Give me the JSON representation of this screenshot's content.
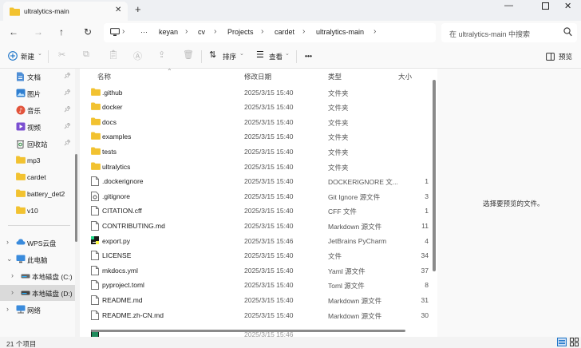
{
  "tab": {
    "title": "ultralytics-main"
  },
  "address": {
    "breadcrumbs": [
      "keyan",
      "cv",
      "Projects",
      "cardet",
      "ultralytics-main"
    ],
    "ellipsis": "···"
  },
  "search": {
    "placeholder": "在 ultralytics-main 中搜索"
  },
  "toolbar": {
    "new_label": "新建",
    "sort_label": "排序",
    "view_label": "查看",
    "more_label": "•••",
    "preview_label": "预览"
  },
  "sidebar": {
    "pinned": [
      {
        "label": "文档",
        "icon": "documents-icon"
      },
      {
        "label": "图片",
        "icon": "pictures-icon"
      },
      {
        "label": "音乐",
        "icon": "music-icon"
      },
      {
        "label": "视频",
        "icon": "videos-icon"
      },
      {
        "label": "回收站",
        "icon": "recycle-bin-icon"
      }
    ],
    "folders": [
      "mp3",
      "cardet",
      "battery_det2",
      "v10"
    ],
    "tree": [
      {
        "label": "WPS云盘"
      },
      {
        "label": "此电脑"
      },
      {
        "label": "本地磁盘 (C:)"
      },
      {
        "label": "本地磁盘 (D:)"
      },
      {
        "label": "网络"
      }
    ]
  },
  "columns": {
    "name": "名称",
    "date": "修改日期",
    "type": "类型",
    "size": "大小"
  },
  "files": [
    {
      "name": ".github",
      "date": "2025/3/15 15:40",
      "type": "文件夹",
      "size": "",
      "icon": "folder"
    },
    {
      "name": "docker",
      "date": "2025/3/15 15:40",
      "type": "文件夹",
      "size": "",
      "icon": "folder"
    },
    {
      "name": "docs",
      "date": "2025/3/15 15:40",
      "type": "文件夹",
      "size": "",
      "icon": "folder"
    },
    {
      "name": "examples",
      "date": "2025/3/15 15:40",
      "type": "文件夹",
      "size": "",
      "icon": "folder"
    },
    {
      "name": "tests",
      "date": "2025/3/15 15:40",
      "type": "文件夹",
      "size": "",
      "icon": "folder"
    },
    {
      "name": "ultralytics",
      "date": "2025/3/15 15:40",
      "type": "文件夹",
      "size": "",
      "icon": "folder"
    },
    {
      "name": ".dockerignore",
      "date": "2025/3/15 15:40",
      "type": "DOCKERIGNORE 文...",
      "size": "1",
      "icon": "file"
    },
    {
      "name": ".gitignore",
      "date": "2025/3/15 15:40",
      "type": "Git Ignore 源文件",
      "size": "3",
      "icon": "gear-file"
    },
    {
      "name": "CITATION.cff",
      "date": "2025/3/15 15:40",
      "type": "CFF 文件",
      "size": "1",
      "icon": "file"
    },
    {
      "name": "CONTRIBUTING.md",
      "date": "2025/3/15 15:40",
      "type": "Markdown 源文件",
      "size": "11",
      "icon": "file"
    },
    {
      "name": "export.py",
      "date": "2025/3/15 15:46",
      "type": "JetBrains PyCharm",
      "size": "4",
      "icon": "pycharm"
    },
    {
      "name": "LICENSE",
      "date": "2025/3/15 15:40",
      "type": "文件",
      "size": "34",
      "icon": "file"
    },
    {
      "name": "mkdocs.yml",
      "date": "2025/3/15 15:40",
      "type": "Yaml 源文件",
      "size": "37",
      "icon": "file"
    },
    {
      "name": "pyproject.toml",
      "date": "2025/3/15 15:40",
      "type": "Toml 源文件",
      "size": "8",
      "icon": "file"
    },
    {
      "name": "README.md",
      "date": "2025/3/15 15:40",
      "type": "Markdown 源文件",
      "size": "31",
      "icon": "file"
    },
    {
      "name": "README.zh-CN.md",
      "date": "2025/3/15 15:40",
      "type": "Markdown 源文件",
      "size": "30",
      "icon": "file"
    }
  ],
  "preview": {
    "message": "选择要预览的文件。"
  },
  "status": {
    "item_count": "21 个项目"
  },
  "colors": {
    "folder": "#f2c230",
    "selection": "#dadada",
    "accent": "#1a73c8"
  }
}
